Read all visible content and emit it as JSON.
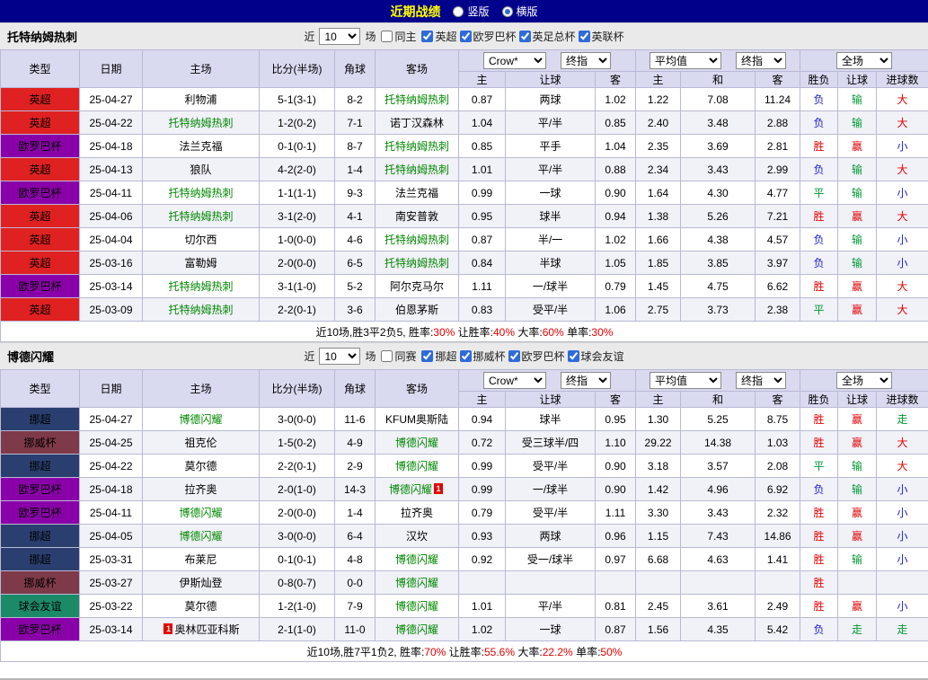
{
  "title_bar": {
    "title": "近期战绩",
    "layout_options": [
      {
        "label": "竖版",
        "checked": false
      },
      {
        "label": "横版",
        "checked": true
      }
    ]
  },
  "league_colors": {
    "英超": "#e02121",
    "欧罗巴杯": "#8a00a8",
    "挪超": "#2a3f6f",
    "挪威杯": "#7e3a48",
    "球会友谊": "#1b8a67"
  },
  "result_colors": {
    "胜": "#e60000",
    "赢": "#e60000",
    "大": "#e60000",
    "负": "#2121cc",
    "小": "#2121cc",
    "平": "#009933",
    "输": "#009933",
    "走": "#009933"
  },
  "sections": [
    {
      "team": "托特纳姆热刺",
      "filter": {
        "near": "近",
        "count": "10",
        "games": "场",
        "same_label": "同主",
        "same_checked": false,
        "leagues": [
          "英超",
          "欧罗巴杯",
          "英足总杯",
          "英联杯"
        ]
      },
      "selects": {
        "bookmaker": "Crow*",
        "final1": "终指",
        "average": "平均值",
        "final2": "终指",
        "scope": "全场"
      },
      "columns": {
        "type": "类型",
        "date": "日期",
        "home": "主场",
        "score": "比分(半场)",
        "corner": "角球",
        "away": "客场",
        "h": "主",
        "handicap": "让球",
        "a": "客",
        "h2": "主",
        "draw": "和",
        "a2": "客",
        "result": "胜负",
        "handicap_result": "让球",
        "goals": "进球数"
      },
      "rows": [
        {
          "league": "英超",
          "date": "25-04-27",
          "home": "利物浦",
          "home_focus": false,
          "score": "5-1(3-1)",
          "corner": "8-2",
          "away": "托特纳姆热刺",
          "away_focus": true,
          "odds": [
            "0.87",
            "两球",
            "1.02",
            "1.22",
            "7.08",
            "11.24"
          ],
          "results": [
            "负",
            "输",
            "大"
          ]
        },
        {
          "league": "英超",
          "date": "25-04-22",
          "home": "托特纳姆热刺",
          "home_focus": true,
          "score": "1-2(0-2)",
          "corner": "7-1",
          "away": "诺丁汉森林",
          "away_focus": false,
          "odds": [
            "1.04",
            "平/半",
            "0.85",
            "2.40",
            "3.48",
            "2.88"
          ],
          "results": [
            "负",
            "输",
            "大"
          ]
        },
        {
          "league": "欧罗巴杯",
          "date": "25-04-18",
          "home": "法兰克福",
          "home_focus": false,
          "score": "0-1(0-1)",
          "corner": "8-7",
          "away": "托特纳姆热刺",
          "away_focus": true,
          "odds": [
            "0.85",
            "平手",
            "1.04",
            "2.35",
            "3.69",
            "2.81"
          ],
          "results": [
            "胜",
            "赢",
            "小"
          ]
        },
        {
          "league": "英超",
          "date": "25-04-13",
          "home": "狼队",
          "home_focus": false,
          "score": "4-2(2-0)",
          "corner": "1-4",
          "away": "托特纳姆热刺",
          "away_focus": true,
          "odds": [
            "1.01",
            "平/半",
            "0.88",
            "2.34",
            "3.43",
            "2.99"
          ],
          "results": [
            "负",
            "输",
            "大"
          ]
        },
        {
          "league": "欧罗巴杯",
          "date": "25-04-11",
          "home": "托特纳姆热刺",
          "home_focus": true,
          "score": "1-1(1-1)",
          "corner": "9-3",
          "away": "法兰克福",
          "away_focus": false,
          "odds": [
            "0.99",
            "一球",
            "0.90",
            "1.64",
            "4.30",
            "4.77"
          ],
          "results": [
            "平",
            "输",
            "小"
          ]
        },
        {
          "league": "英超",
          "date": "25-04-06",
          "home": "托特纳姆热刺",
          "home_focus": true,
          "score": "3-1(2-0)",
          "corner": "4-1",
          "away": "南安普敦",
          "away_focus": false,
          "odds": [
            "0.95",
            "球半",
            "0.94",
            "1.38",
            "5.26",
            "7.21"
          ],
          "results": [
            "胜",
            "赢",
            "大"
          ]
        },
        {
          "league": "英超",
          "date": "25-04-04",
          "home": "切尔西",
          "home_focus": false,
          "score": "1-0(0-0)",
          "corner": "4-6",
          "away": "托特纳姆热刺",
          "away_focus": true,
          "odds": [
            "0.87",
            "半/一",
            "1.02",
            "1.66",
            "4.38",
            "4.57"
          ],
          "results": [
            "负",
            "输",
            "小"
          ]
        },
        {
          "league": "英超",
          "date": "25-03-16",
          "home": "富勒姆",
          "home_focus": false,
          "score": "2-0(0-0)",
          "corner": "6-5",
          "away": "托特纳姆热刺",
          "away_focus": true,
          "odds": [
            "0.84",
            "半球",
            "1.05",
            "1.85",
            "3.85",
            "3.97"
          ],
          "results": [
            "负",
            "输",
            "小"
          ]
        },
        {
          "league": "欧罗巴杯",
          "date": "25-03-14",
          "home": "托特纳姆热刺",
          "home_focus": true,
          "score": "3-1(1-0)",
          "corner": "5-2",
          "away": "阿尔克马尔",
          "away_focus": false,
          "odds": [
            "1.11",
            "一/球半",
            "0.79",
            "1.45",
            "4.75",
            "6.62"
          ],
          "results": [
            "胜",
            "赢",
            "大"
          ]
        },
        {
          "league": "英超",
          "date": "25-03-09",
          "home": "托特纳姆热刺",
          "home_focus": true,
          "score": "2-2(0-1)",
          "corner": "3-6",
          "away": "伯恩茅斯",
          "away_focus": false,
          "odds": [
            "0.83",
            "受平/半",
            "1.06",
            "2.75",
            "3.73",
            "2.38"
          ],
          "results": [
            "平",
            "赢",
            "大"
          ]
        }
      ],
      "summary": {
        "prefix": "近10场,胜3平2负5,",
        "stats": [
          {
            "label": "胜率:",
            "value": "30%"
          },
          {
            "label": "让胜率:",
            "value": "40%"
          },
          {
            "label": "大率:",
            "value": "60%"
          },
          {
            "label": "单率:",
            "value": "30%"
          }
        ]
      }
    },
    {
      "team": "博德闪耀",
      "filter": {
        "near": "近",
        "count": "10",
        "games": "场",
        "same_label": "同赛",
        "same_checked": false,
        "leagues": [
          "挪超",
          "挪威杯",
          "欧罗巴杯",
          "球会友谊"
        ]
      },
      "selects": {
        "bookmaker": "Crow*",
        "final1": "终指",
        "average": "平均值",
        "final2": "终指",
        "scope": "全场"
      },
      "columns": {
        "type": "类型",
        "date": "日期",
        "home": "主场",
        "score": "比分(半场)",
        "corner": "角球",
        "away": "客场",
        "h": "主",
        "handicap": "让球",
        "a": "客",
        "h2": "主",
        "draw": "和",
        "a2": "客",
        "result": "胜负",
        "handicap_result": "让球",
        "goals": "进球数"
      },
      "rows": [
        {
          "league": "挪超",
          "date": "25-04-27",
          "home": "博德闪耀",
          "home_focus": true,
          "score": "3-0(0-0)",
          "corner": "11-6",
          "away": "KFUM奥斯陆",
          "away_focus": false,
          "odds": [
            "0.94",
            "球半",
            "0.95",
            "1.30",
            "5.25",
            "8.75"
          ],
          "results": [
            "胜",
            "赢",
            "走"
          ]
        },
        {
          "league": "挪威杯",
          "date": "25-04-25",
          "home": "祖克伦",
          "home_focus": false,
          "score": "1-5(0-2)",
          "corner": "4-9",
          "away": "博德闪耀",
          "away_focus": true,
          "odds": [
            "0.72",
            "受三球半/四",
            "1.10",
            "29.22",
            "14.38",
            "1.03"
          ],
          "results": [
            "胜",
            "赢",
            "大"
          ]
        },
        {
          "league": "挪超",
          "date": "25-04-22",
          "home": "莫尔德",
          "home_focus": false,
          "score": "2-2(0-1)",
          "corner": "2-9",
          "away": "博德闪耀",
          "away_focus": true,
          "odds": [
            "0.99",
            "受平/半",
            "0.90",
            "3.18",
            "3.57",
            "2.08"
          ],
          "results": [
            "平",
            "输",
            "大"
          ]
        },
        {
          "league": "欧罗巴杯",
          "date": "25-04-18",
          "home": "拉齐奥",
          "home_focus": false,
          "score": "2-0(1-0)",
          "corner": "14-3",
          "away": "博德闪耀",
          "away_focus": true,
          "away_card": "1",
          "odds": [
            "0.99",
            "一/球半",
            "0.90",
            "1.42",
            "4.96",
            "6.92"
          ],
          "results": [
            "负",
            "输",
            "小"
          ]
        },
        {
          "league": "欧罗巴杯",
          "date": "25-04-11",
          "home": "博德闪耀",
          "home_focus": true,
          "score": "2-0(0-0)",
          "corner": "1-4",
          "away": "拉齐奥",
          "away_focus": false,
          "odds": [
            "0.79",
            "受平/半",
            "1.11",
            "3.30",
            "3.43",
            "2.32"
          ],
          "results": [
            "胜",
            "赢",
            "小"
          ]
        },
        {
          "league": "挪超",
          "date": "25-04-05",
          "home": "博德闪耀",
          "home_focus": true,
          "score": "3-0(0-0)",
          "corner": "6-4",
          "away": "汉坎",
          "away_focus": false,
          "odds": [
            "0.93",
            "两球",
            "0.96",
            "1.15",
            "7.43",
            "14.86"
          ],
          "results": [
            "胜",
            "赢",
            "小"
          ]
        },
        {
          "league": "挪超",
          "date": "25-03-31",
          "home": "布莱尼",
          "home_focus": false,
          "score": "0-1(0-1)",
          "corner": "4-8",
          "away": "博德闪耀",
          "away_focus": true,
          "odds": [
            "0.92",
            "受一/球半",
            "0.97",
            "6.68",
            "4.63",
            "1.41"
          ],
          "results": [
            "胜",
            "输",
            "小"
          ]
        },
        {
          "league": "挪威杯",
          "date": "25-03-27",
          "home": "伊斯灿登",
          "home_focus": false,
          "score": "0-8(0-7)",
          "corner": "0-0",
          "away": "博德闪耀",
          "away_focus": true,
          "odds": [
            "",
            "",
            "",
            "",
            "",
            ""
          ],
          "results": [
            "胜",
            "",
            ""
          ]
        },
        {
          "league": "球会友谊",
          "date": "25-03-22",
          "home": "莫尔德",
          "home_focus": false,
          "score": "1-2(1-0)",
          "corner": "7-9",
          "away": "博德闪耀",
          "away_focus": true,
          "odds": [
            "1.01",
            "平/半",
            "0.81",
            "2.45",
            "3.61",
            "2.49"
          ],
          "results": [
            "胜",
            "赢",
            "小"
          ]
        },
        {
          "league": "欧罗巴杯",
          "date": "25-03-14",
          "home": "奥林匹亚科斯",
          "home_focus": false,
          "home_card": "1",
          "score": "2-1(1-0)",
          "corner": "11-0",
          "away": "博德闪耀",
          "away_focus": true,
          "odds": [
            "1.02",
            "一球",
            "0.87",
            "1.56",
            "4.35",
            "5.42"
          ],
          "results": [
            "负",
            "走",
            "走"
          ]
        }
      ],
      "summary": {
        "prefix": "近10场,胜7平1负2,",
        "stats": [
          {
            "label": "胜率:",
            "value": "70%"
          },
          {
            "label": "让胜率:",
            "value": "55.6%"
          },
          {
            "label": "大率:",
            "value": "22.2%"
          },
          {
            "label": "单率:",
            "value": "50%"
          }
        ]
      }
    }
  ]
}
